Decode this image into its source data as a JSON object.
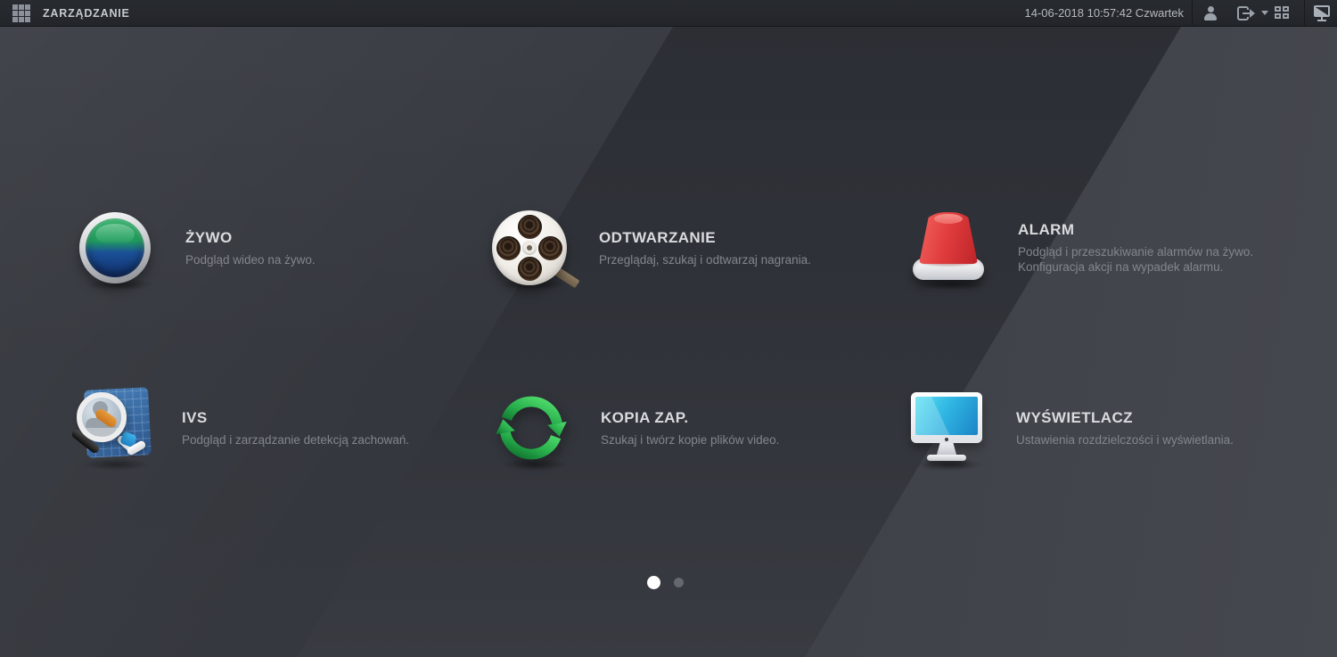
{
  "header": {
    "app_icon": "grid-menu-icon",
    "title": "ZARZĄDZANIE",
    "datetime": "14-06-2018 10:57:42 Czwartek",
    "right_icons": [
      "user-icon",
      "logout-icon",
      "logout-caret-icon",
      "qr-code-icon",
      "display-output-icon"
    ]
  },
  "menu": {
    "items": [
      {
        "id": "live",
        "title": "ŻYWO",
        "icon": "live-button-icon",
        "desc_lines": [
          "Podgląd wideo na żywo."
        ]
      },
      {
        "id": "playback",
        "title": "ODTWARZANIE",
        "icon": "film-reel-icon",
        "desc_lines": [
          "Przeglądaj, szukaj i odtwarzaj nagrania."
        ]
      },
      {
        "id": "alarm",
        "title": "ALARM",
        "icon": "siren-icon",
        "desc_lines": [
          "Podgląd i przeszukiwanie alarmów na żywo.",
          "Konfiguracja akcji na wypadek alarmu."
        ]
      },
      {
        "id": "ivs",
        "title": "IVS",
        "icon": "behavior-search-icon",
        "desc_lines": [
          "Podgląd i zarządzanie detekcją zachowań."
        ]
      },
      {
        "id": "backup",
        "title": "KOPIA ZAP.",
        "icon": "backup-sync-icon",
        "desc_lines": [
          "Szukaj i twórz kopie plików video."
        ]
      },
      {
        "id": "display",
        "title": "WYŚWIETLACZ",
        "icon": "monitor-icon",
        "desc_lines": [
          "Ustawienia rozdzielczości i wyświetlania."
        ]
      }
    ]
  },
  "pagination": {
    "current_page": 1,
    "total_pages": 2
  },
  "colors": {
    "topbar": "#24272c",
    "background": "#33363c",
    "accent_green": "#2fb45e",
    "accent_red": "#d93a3c",
    "accent_blue": "#2fb4e2",
    "title_text": "#d9dbde",
    "desc_text": "#83868c"
  }
}
